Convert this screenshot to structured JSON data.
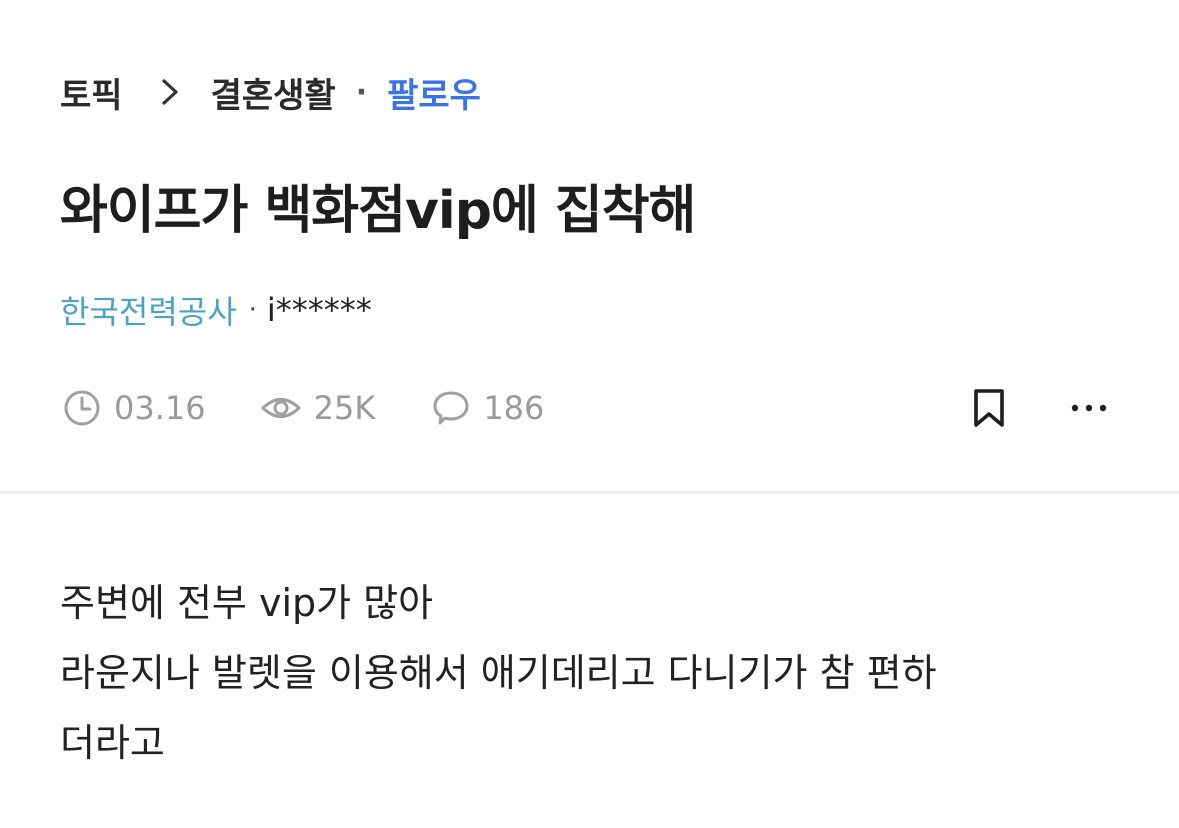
{
  "breadcrumb": {
    "root": "토픽",
    "category": "결혼생활",
    "separator": "·",
    "follow_label": "팔로우"
  },
  "post": {
    "title": "와이프가 백화점vip에 집착해",
    "author_company": "한국전력공사",
    "author_separator": "·",
    "author_name": "i******",
    "date": "03.16",
    "views": "25K",
    "comments": "186",
    "body_lines": [
      "주변에 전부 vip가 많아",
      "라운지나 발렛을 이용해서 애기데리고 다니기가 참 편하",
      "더라고"
    ]
  },
  "icons": {
    "chevron": "chevron-right-icon",
    "clock": "clock-icon",
    "eye": "eye-icon",
    "comment": "comment-icon",
    "bookmark": "bookmark-icon",
    "more": "more-icon"
  },
  "colors": {
    "follow": "#3a73e6",
    "company": "#4aa3c0",
    "meta": "#9a9a9a",
    "text": "#222222"
  }
}
